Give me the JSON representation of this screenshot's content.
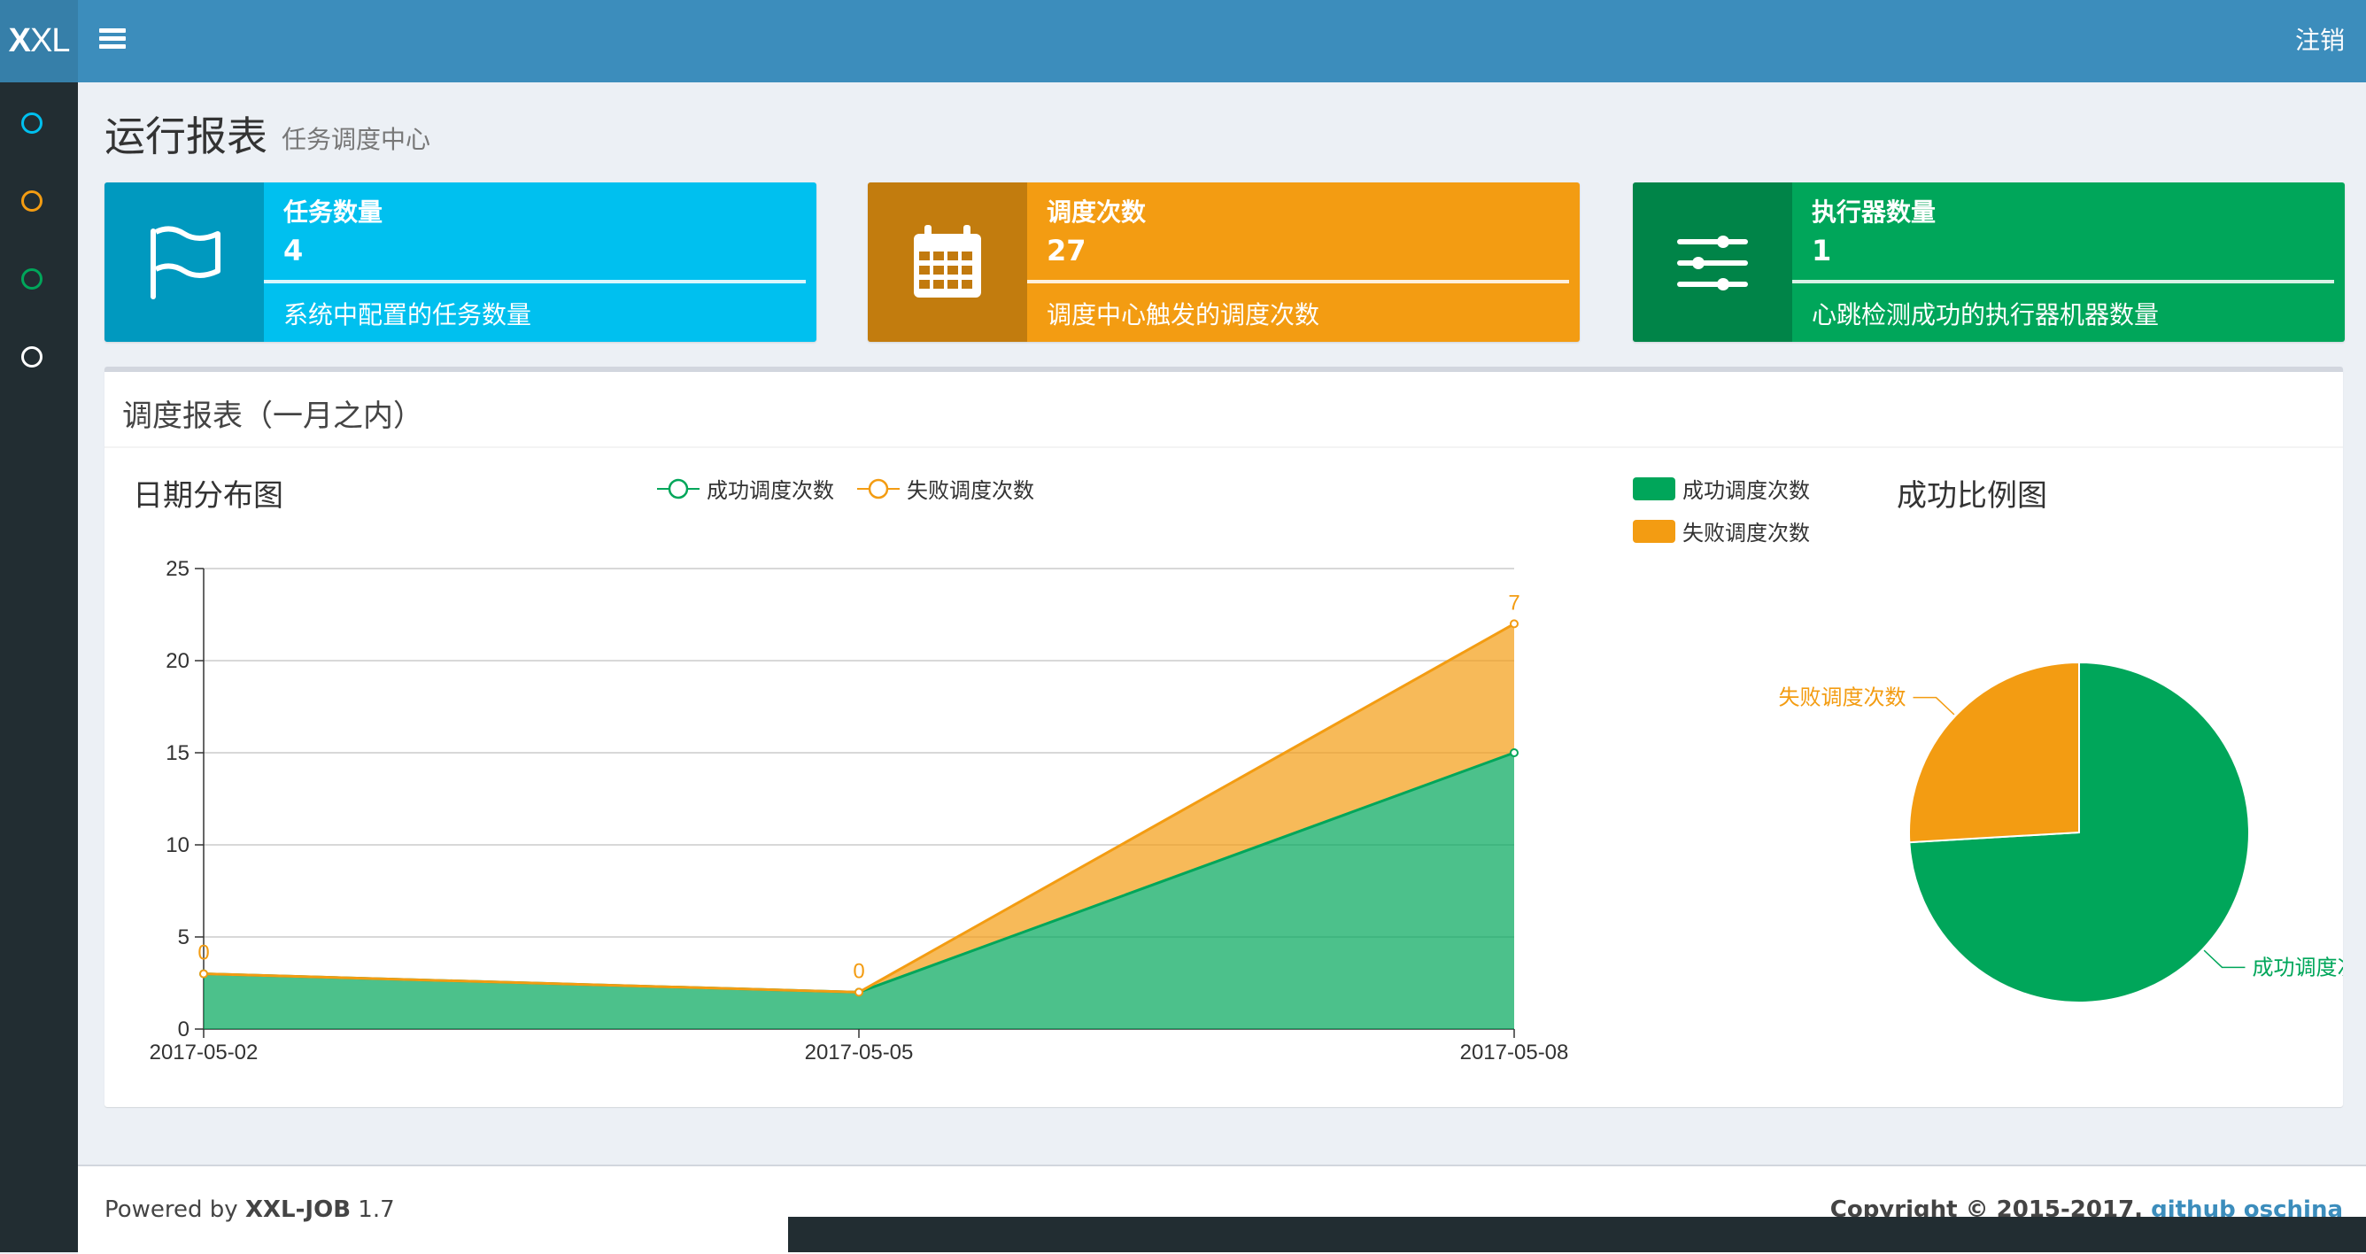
{
  "header": {
    "logo_bold": "X",
    "logo_rest": "XL",
    "logout_label": "注销"
  },
  "page": {
    "title": "运行报表",
    "subtitle": "任务调度中心"
  },
  "info_boxes": [
    {
      "label": "任务数量",
      "value": "4",
      "desc": "系统中配置的任务数量",
      "color": "#00c0ef",
      "icon": "flag-icon"
    },
    {
      "label": "调度次数",
      "value": "27",
      "desc": "调度中心触发的调度次数",
      "color": "#f39c12",
      "icon": "calendar-icon"
    },
    {
      "label": "执行器数量",
      "value": "1",
      "desc": "心跳检测成功的执行器机器数量",
      "color": "#00a65a",
      "icon": "sliders-icon"
    }
  ],
  "report": {
    "title": "调度报表（一月之内）"
  },
  "chart_data": [
    {
      "type": "area",
      "title": "日期分布图",
      "x": [
        "2017-05-02",
        "2017-05-05",
        "2017-05-08"
      ],
      "series": [
        {
          "name": "成功调度次数",
          "values": [
            3,
            2,
            15
          ],
          "color": "#00a65a"
        },
        {
          "name": "失败调度次数",
          "values": [
            0,
            0,
            7
          ],
          "color": "#f39c12"
        }
      ],
      "stacked": true,
      "ylim": [
        0,
        25
      ],
      "yticks": [
        0,
        5,
        10,
        15,
        20,
        25
      ],
      "grid": true,
      "legend": "top-center"
    },
    {
      "type": "pie",
      "title": "成功比例图",
      "labels": [
        "成功调度次数",
        "失败调度次数"
      ],
      "values": [
        20,
        7
      ],
      "colors": [
        "#00a65a",
        "#f39c12"
      ],
      "legend": "top-left"
    }
  ],
  "footer": {
    "powered_prefix": "Powered by",
    "powered_brand": "XXL-JOB",
    "version": "1.7",
    "copyright": "Copyright © 2015-2017.",
    "link_github": "github",
    "link_oschina": "oschina"
  },
  "sidebar": {
    "items": [
      {
        "color": "#00c0ef"
      },
      {
        "color": "#f39c12"
      },
      {
        "color": "#00a65a"
      },
      {
        "color": "#ffffff"
      }
    ]
  }
}
